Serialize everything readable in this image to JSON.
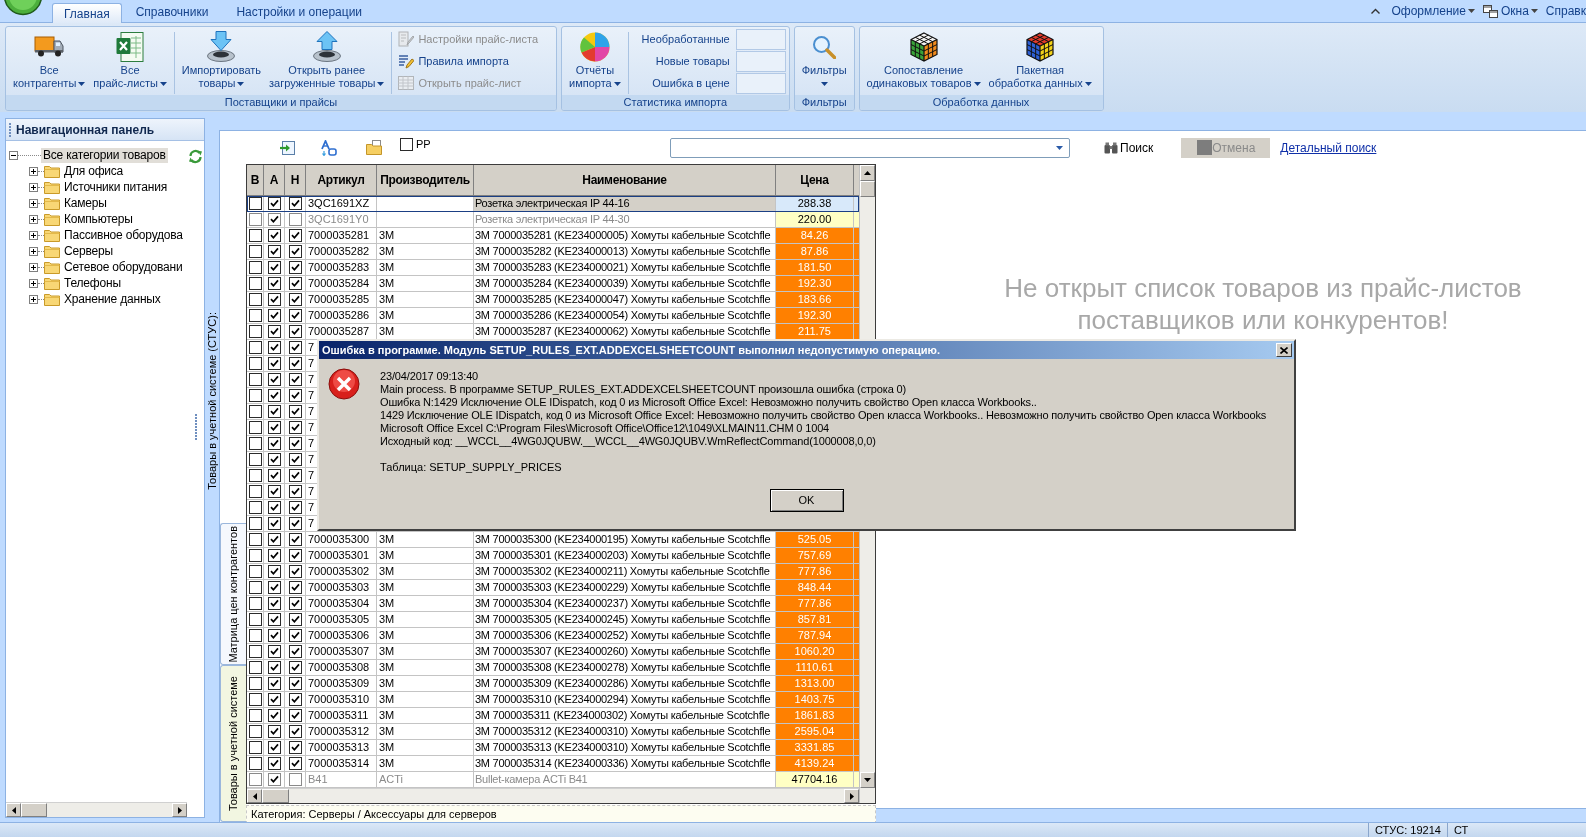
{
  "menu_bar": {
    "tabs": [
      {
        "label": "Главная",
        "selected": true
      },
      {
        "label": "Справочники",
        "selected": false
      },
      {
        "label": "Настройки и операции",
        "selected": false
      }
    ],
    "right_items": [
      {
        "kind": "plain",
        "label": "Оформление",
        "dropdown": true
      },
      {
        "kind": "windows",
        "label": "Окна",
        "dropdown": true
      },
      {
        "kind": "plain",
        "label": "Справк",
        "dropdown": false
      }
    ]
  },
  "ribbon": {
    "groups": [
      {
        "title": "Поставщики и прайсы",
        "items": [
          {
            "kind": "large",
            "lines": [
              "Все",
              "контрагенты"
            ],
            "dropdown": true
          },
          {
            "kind": "large",
            "lines": [
              "Все",
              "прайс-листы"
            ],
            "dropdown": true
          },
          {
            "kind": "separator"
          },
          {
            "kind": "large",
            "lines": [
              "Импортировать",
              "товары"
            ],
            "dropdown": true
          },
          {
            "kind": "large",
            "lines": [
              "Открыть ранее",
              "загруженные товары"
            ],
            "dropdown": true
          },
          {
            "kind": "separator"
          },
          {
            "kind": "small_stack",
            "buttons": [
              {
                "label": "Настройки прайс-листа",
                "disabled": true
              },
              {
                "label": "Правила импорта",
                "disabled": false
              },
              {
                "label": "Открыть прайс-лист",
                "disabled": true
              }
            ]
          }
        ]
      },
      {
        "title": "Статистика импорта",
        "items": [
          {
            "kind": "large",
            "lines": [
              "Отчёты",
              "импорта"
            ],
            "dropdown": true
          },
          {
            "kind": "separator"
          },
          {
            "kind": "stats",
            "rows": [
              {
                "label": "Необработанные"
              },
              {
                "label": "Новые товары"
              },
              {
                "label": "Ошибка в цене"
              }
            ]
          }
        ]
      },
      {
        "title": "Фильтры",
        "items": [
          {
            "kind": "large",
            "lines": [
              "Фильтры"
            ],
            "dropdown": true
          }
        ]
      },
      {
        "title": "Обработка данных",
        "items": [
          {
            "kind": "large",
            "lines": [
              "Сопоставление",
              "одинаковых товаров"
            ],
            "dropdown": true
          },
          {
            "kind": "large",
            "lines": [
              "Пакетная",
              "обработка данных"
            ],
            "dropdown": true
          }
        ]
      }
    ]
  },
  "navigation": {
    "title": "Навигационная панель",
    "tree": [
      {
        "label": "Все категории товаров",
        "expanded": true,
        "selected": true,
        "children": [
          {
            "label": "Для офиса",
            "expanded": false,
            "selected": false
          },
          {
            "label": "Источники питания",
            "expanded": false,
            "selected": false
          },
          {
            "label": "Камеры",
            "expanded": false,
            "selected": false
          },
          {
            "label": "Компьютеры",
            "expanded": false,
            "selected": false
          },
          {
            "label": "Пассивное оборудова",
            "expanded": false,
            "selected": false
          },
          {
            "label": "Серверы",
            "expanded": false,
            "selected": false
          },
          {
            "label": "Сетевое оборудовани",
            "expanded": false,
            "selected": false
          },
          {
            "label": "Телефоны",
            "expanded": false,
            "selected": false
          },
          {
            "label": "Хранение данных",
            "expanded": false,
            "selected": false
          }
        ]
      }
    ]
  },
  "side_caption": "Товары в учетной системе (СТУС):",
  "toolbar": {
    "pp_checkbox": {
      "label": "PP",
      "checked": false
    },
    "search_button": {
      "label": "Поиск",
      "disabled": false
    },
    "cancel_button": {
      "label": "Отмена",
      "disabled": true
    },
    "detail_link": "Детальный поиск"
  },
  "side_tabs": [
    {
      "label": "Матрица цен контрагентов",
      "selected": false
    },
    {
      "label": "Товары в учетной системе",
      "selected": true
    }
  ],
  "table": {
    "columns": [
      "В",
      "А",
      "Н",
      "Артикул",
      "Производитель",
      "Наименование",
      "Цена"
    ],
    "rows": [
      {
        "check_v": false,
        "check_a": true,
        "check_n": true,
        "article": "3QC1691XZ",
        "name": "Розетка электрическая IP 44-16",
        "price": "288.38",
        "color": "#d8e9fa",
        "selected": true,
        "inactive": false
      },
      {
        "check_v": false,
        "check_a": true,
        "check_n": false,
        "article": "3QC1691Y0",
        "name": "Розетка электрическая IP 44-30",
        "price": "220.00",
        "color": "#ffffc4",
        "selected": false,
        "inactive": true
      },
      {
        "check_v": false,
        "check_a": true,
        "check_n": true,
        "article": "7000035281",
        "maker": "3M",
        "name": "3M 7000035281 (KE234000005) Хомуты кабельные Scotchfle",
        "price": "84.26",
        "color": "#ff8000",
        "selected": false,
        "inactive": false
      },
      {
        "check_v": false,
        "check_a": true,
        "check_n": true,
        "article": "7000035282",
        "maker": "3M",
        "name": "3M 7000035282 (KE234000013) Хомуты кабельные Scotchfle",
        "price": "87.86",
        "color": "#ff8000",
        "selected": false,
        "inactive": false
      },
      {
        "check_v": false,
        "check_a": true,
        "check_n": true,
        "article": "7000035283",
        "maker": "3M",
        "name": "3M 7000035283 (KE234000021) Хомуты кабельные Scotchfle",
        "price": "181.50",
        "color": "#ff8000",
        "selected": false,
        "inactive": false
      },
      {
        "check_v": false,
        "check_a": true,
        "check_n": true,
        "article": "7000035284",
        "maker": "3M",
        "name": "3M 7000035284 (KE234000039) Хомуты кабельные Scotchfle",
        "price": "192.30",
        "color": "#ff8000",
        "selected": false,
        "inactive": false
      },
      {
        "check_v": false,
        "check_a": true,
        "check_n": true,
        "article": "7000035285",
        "maker": "3M",
        "name": "3M 7000035285 (KE234000047) Хомуты кабельные Scotchfle",
        "price": "183.66",
        "color": "#ff8000",
        "selected": false,
        "inactive": false
      },
      {
        "check_v": false,
        "check_a": true,
        "check_n": true,
        "article": "7000035286",
        "maker": "3M",
        "name": "3M 7000035286 (KE234000054) Хомуты кабельные Scotchfle",
        "price": "192.30",
        "color": "#ff8000",
        "selected": false,
        "inactive": false
      },
      {
        "check_v": false,
        "check_a": true,
        "check_n": true,
        "article": "7000035287",
        "maker": "3M",
        "name": "3M 7000035287 (KE234000062) Хомуты кабельные Scotchfle",
        "price": "211.75",
        "color": "#ff8000",
        "selected": false,
        "inactive": false
      },
      {
        "check_v": false,
        "check_a": true,
        "check_n": true,
        "article": "7",
        "selected": false,
        "inactive": false
      },
      {
        "check_v": false,
        "check_a": true,
        "check_n": true,
        "article": "7",
        "selected": false,
        "inactive": false
      },
      {
        "check_v": false,
        "check_a": true,
        "check_n": true,
        "article": "7",
        "selected": false,
        "inactive": false
      },
      {
        "check_v": false,
        "check_a": true,
        "check_n": true,
        "article": "7",
        "selected": false,
        "inactive": false
      },
      {
        "check_v": false,
        "check_a": true,
        "check_n": true,
        "article": "7",
        "selected": false,
        "inactive": false
      },
      {
        "check_v": false,
        "check_a": true,
        "check_n": true,
        "article": "7",
        "selected": false,
        "inactive": false
      },
      {
        "check_v": false,
        "check_a": true,
        "check_n": true,
        "article": "7",
        "selected": false,
        "inactive": false
      },
      {
        "check_v": false,
        "check_a": true,
        "check_n": true,
        "article": "7",
        "selected": false,
        "inactive": false
      },
      {
        "check_v": false,
        "check_a": true,
        "check_n": true,
        "article": "7",
        "selected": false,
        "inactive": false
      },
      {
        "check_v": false,
        "check_a": true,
        "check_n": true,
        "article": "7",
        "selected": false,
        "inactive": false
      },
      {
        "check_v": false,
        "check_a": true,
        "check_n": true,
        "article": "7",
        "selected": false,
        "inactive": false
      },
      {
        "check_v": false,
        "check_a": true,
        "check_n": true,
        "article": "7",
        "selected": false,
        "inactive": false
      },
      {
        "check_v": false,
        "check_a": true,
        "check_n": true,
        "article": "7000035300",
        "maker": "3M",
        "name": "3M 7000035300 (KE234000195) Хомуты кабельные Scotchfle",
        "price": "525.05",
        "color": "#ff8000",
        "selected": false,
        "inactive": false
      },
      {
        "check_v": false,
        "check_a": true,
        "check_n": true,
        "article": "7000035301",
        "maker": "3M",
        "name": "3M 7000035301 (KE234000203) Хомуты кабельные Scotchfle",
        "price": "757.69",
        "color": "#ff8000",
        "selected": false,
        "inactive": false
      },
      {
        "check_v": false,
        "check_a": true,
        "check_n": true,
        "article": "7000035302",
        "maker": "3M",
        "name": "3M 7000035302 (KE234000211) Хомуты кабельные Scotchfle",
        "price": "777.86",
        "color": "#ff8000",
        "selected": false,
        "inactive": false
      },
      {
        "check_v": false,
        "check_a": true,
        "check_n": true,
        "article": "7000035303",
        "maker": "3M",
        "name": "3M 7000035303 (KE234000229) Хомуты кабельные Scotchfle",
        "price": "848.44",
        "color": "#ff8000",
        "selected": false,
        "inactive": false
      },
      {
        "check_v": false,
        "check_a": true,
        "check_n": true,
        "article": "7000035304",
        "maker": "3M",
        "name": "3M 7000035304 (KE234000237) Хомуты кабельные Scotchfle",
        "price": "777.86",
        "color": "#ff8000",
        "selected": false,
        "inactive": false
      },
      {
        "check_v": false,
        "check_a": true,
        "check_n": true,
        "article": "7000035305",
        "maker": "3M",
        "name": "3M 7000035305 (KE234000245) Хомуты кабельные Scotchfle",
        "price": "857.81",
        "color": "#ff8000",
        "selected": false,
        "inactive": false
      },
      {
        "check_v": false,
        "check_a": true,
        "check_n": true,
        "article": "7000035306",
        "maker": "3M",
        "name": "3M 7000035306 (KE234000252) Хомуты кабельные Scotchfle",
        "price": "787.94",
        "color": "#ff8000",
        "selected": false,
        "inactive": false
      },
      {
        "check_v": false,
        "check_a": true,
        "check_n": true,
        "article": "7000035307",
        "maker": "3M",
        "name": "3M 7000035307 (KE234000260) Хомуты кабельные Scotchfle",
        "price": "1060.20",
        "color": "#ff8000",
        "selected": false,
        "inactive": false
      },
      {
        "check_v": false,
        "check_a": true,
        "check_n": true,
        "article": "7000035308",
        "maker": "3M",
        "name": "3M 7000035308 (KE234000278) Хомуты кабельные Scotchfle",
        "price": "1110.61",
        "color": "#ff8000",
        "selected": false,
        "inactive": false
      },
      {
        "check_v": false,
        "check_a": true,
        "check_n": true,
        "article": "7000035309",
        "maker": "3M",
        "name": "3M 7000035309 (KE234000286) Хомуты кабельные Scotchfle",
        "price": "1313.00",
        "color": "#ff8000",
        "selected": false,
        "inactive": false
      },
      {
        "check_v": false,
        "check_a": true,
        "check_n": true,
        "article": "7000035310",
        "maker": "3M",
        "name": "3M 7000035310 (KE234000294) Хомуты кабельные Scotchfle",
        "price": "1403.75",
        "color": "#ff8000",
        "selected": false,
        "inactive": false
      },
      {
        "check_v": false,
        "check_a": true,
        "check_n": true,
        "article": "7000035311",
        "maker": "3M",
        "name": "3M 7000035311 (KE234000302) Хомуты кабельные Scotchfle",
        "price": "1861.83",
        "color": "#ff8000",
        "selected": false,
        "inactive": false
      },
      {
        "check_v": false,
        "check_a": true,
        "check_n": true,
        "article": "7000035312",
        "maker": "3M",
        "name": "3M 7000035312 (KE234000310) Хомуты кабельные Scotchfle",
        "price": "2595.04",
        "color": "#ff8000",
        "selected": false,
        "inactive": false
      },
      {
        "check_v": false,
        "check_a": true,
        "check_n": true,
        "article": "7000035313",
        "maker": "3M",
        "name": "3M 7000035313 (KE234000310) Хомуты кабельные Scotchfle",
        "price": "3331.85",
        "color": "#ff8000",
        "selected": false,
        "inactive": false
      },
      {
        "check_v": false,
        "check_a": true,
        "check_n": true,
        "article": "7000035314",
        "maker": "3M",
        "name": "3M 7000035314 (KE234000336) Хомуты кабельные Scotchfle",
        "price": "4139.24",
        "color": "#ff8000",
        "selected": false,
        "inactive": false
      },
      {
        "check_v": false,
        "check_a": true,
        "check_n": false,
        "article": "B41",
        "maker": "ACTi",
        "name": "Bullet-камера ACTi B41",
        "price": "47704.16",
        "color": "#ffffc4",
        "selected": false,
        "inactive": true
      }
    ]
  },
  "category_footer": "Категория: Серверы / Аксессуары для серверов",
  "empty_message": "Не открыт список товаров из прайс-листов поставщиков или конкурентов!",
  "status_bar": [
    "СТУС: 19214",
    "СТ"
  ],
  "error_dialog": {
    "title": "Ошибка в программе. Модуль SETUP_RULES_EXT.ADDEXCELSHEETCOUNT выполнил недопустимую операцию.",
    "lines": [
      "23/04/2017 09:13:40",
      "Main process. В программе SETUP_RULES_EXT.ADDEXCELSHEETCOUNT произошла ошибка (строка 0)",
      "Ошибка N:1429 Исключение OLE IDispatch, код 0 из Microsoft Office Excel: Невозможно получить свойство Open класса Workbooks..",
      "1429 Исключение OLE IDispatch, код 0 из Microsoft Office Excel: Невозможно получить свойство Open класса Workbooks.. Невозможно получить свойство Open класса Workbooks",
      "Microsoft Office Excel C:\\Program Files\\Microsoft Office\\Office12\\1049\\XLMAIN11.CHM 0 1004",
      "Исходный код: __WCCL__4WG0JQUBW.__WCCL__4WG0JQUBV.WmReflectCommand(1000008,0,0)"
    ],
    "table_line": "Таблица: SETUP_SUPPLY_PRICES",
    "button": "OK"
  }
}
